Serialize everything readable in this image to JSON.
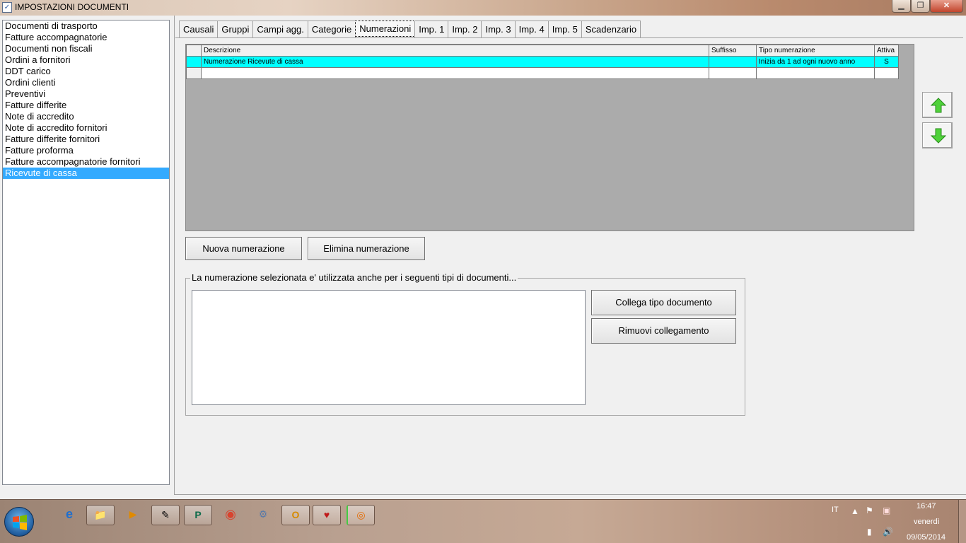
{
  "window": {
    "title": "IMPOSTAZIONI DOCUMENTI",
    "minimize": "▁",
    "maximize": "❐",
    "close": "✕"
  },
  "doc_types": [
    "Documenti di trasporto",
    "Fatture accompagnatorie",
    "Documenti non fiscali",
    "Ordini a fornitori",
    "DDT carico",
    "Ordini clienti",
    "Preventivi",
    "Fatture differite",
    "Note di accredito",
    "Note di accredito fornitori",
    "Fatture differite fornitori",
    "Fatture proforma",
    "Fatture accompagnatorie fornitori",
    "Ricevute di cassa"
  ],
  "selected_doc_type": "Ricevute di cassa",
  "tabs": [
    "Causali",
    "Gruppi",
    "Campi agg.",
    "Categorie",
    "Numerazioni",
    "Imp. 1",
    "Imp. 2",
    "Imp. 3",
    "Imp. 4",
    "Imp. 5",
    "Scadenzario"
  ],
  "active_tab": "Numerazioni",
  "grid": {
    "columns": [
      "Descrizione",
      "Suffisso",
      "Tipo numerazione",
      "Attiva"
    ],
    "rows": [
      [
        "Numerazione Ricevute di cassa",
        "",
        "Inizia da 1 ad ogni nuovo anno",
        "S"
      ]
    ]
  },
  "buttons": {
    "new_numbering": "Nuova numerazione",
    "delete_numbering": "Elimina numerazione",
    "link_doc_type": "Collega tipo documento",
    "remove_link": "Rimuovi collegamento"
  },
  "linked_group": {
    "legend": "La numerazione selezionata e' utilizzata anche per i seguenti tipi di documenti..."
  },
  "taskbar": {
    "language": "IT",
    "time": "16:47",
    "day": "venerdì",
    "date": "09/05/2014"
  },
  "colors": {
    "selection_blue": "#33aaff",
    "grid_selected_row": "#00ffff",
    "grid_background": "#ababab"
  }
}
